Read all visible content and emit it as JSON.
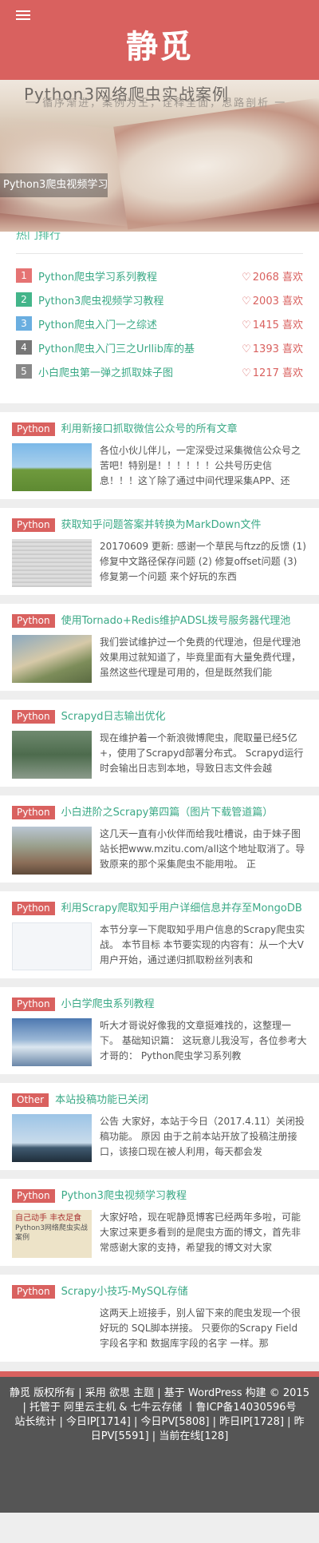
{
  "site": {
    "title": "静觅"
  },
  "banner": {
    "image_title_line1": "Python3网络爬虫实战案例",
    "image_title_line2": "一 循序渐进，案例为王，诠释全面，思路剖析 一",
    "caption": "Python3爬虫视频学习教程"
  },
  "rank": {
    "title": "热门排行",
    "items": [
      {
        "num": "1",
        "color": "#e57373",
        "title": "Python爬虫学习系列教程",
        "likes": "2068 喜欢"
      },
      {
        "num": "2",
        "color": "#43b58a",
        "title": "Python3爬虫视频学习教程",
        "likes": "2003 喜欢"
      },
      {
        "num": "3",
        "color": "#6aaee0",
        "title": "Python爬虫入门一之综述",
        "likes": "1415 喜欢"
      },
      {
        "num": "4",
        "color": "#777777",
        "title": "Python爬虫入门三之Urllib库的基",
        "likes": "1393 喜欢"
      },
      {
        "num": "5",
        "color": "#888888",
        "title": "小白爬虫第一弹之抓取妹子图",
        "likes": "1217 喜欢"
      }
    ]
  },
  "posts": [
    {
      "category": "Python",
      "title": "利用新接口抓取微信公众号的所有文章",
      "thumb": "t1",
      "excerpt": "各位小伙儿伴儿，一定深受过采集微信公众号之苦吧！特别是！！！！！！公共号历史信息！！！这丫除了通过中间代理采集APP、还"
    },
    {
      "category": "Python",
      "title": "获取知乎问题答案并转换为MarkDown文件",
      "thumb": "t2",
      "excerpt": "20170609 更新: 感谢一个草民与ftzz的反馈 (1) 修复中文路径保存问题 (2) 修复offset问题 (3) 修复第一个问题 来个好玩的东西"
    },
    {
      "category": "Python",
      "title": "使用Tornado+Redis维护ADSL拨号服务器代理池",
      "thumb": "t3",
      "excerpt": "我们尝试维护过一个免费的代理池，但是代理池效果用过就知道了，毕竟里面有大量免费代理，虽然这些代理是可用的，但是既然我们能"
    },
    {
      "category": "Python",
      "title": "Scrapyd日志输出优化",
      "thumb": "t4",
      "excerpt": "现在维护着一个新浪微博爬虫，爬取量已经5亿+，使用了Scrapyd部署分布式。 Scrapyd运行时会输出日志到本地，导致日志文件会越"
    },
    {
      "category": "Python",
      "title": "小白进阶之Scrapy第四篇（图片下载管道篇）",
      "thumb": "t5",
      "excerpt": "这几天一直有小伙伴而给我吐槽说，由于妹子图站长把www.mzitu.com/all这个地址取消了。导致原来的那个采集爬虫不能用啦。 正"
    },
    {
      "category": "Python",
      "title": "利用Scrapy爬取知乎用户详细信息并存至MongoDB",
      "thumb": "t6",
      "excerpt": "本节分享一下爬取知乎用户信息的Scrapy爬虫实战。 本节目标 本节要实现的内容有：从一个大V用户开始，通过递归抓取粉丝列表和"
    },
    {
      "category": "Python",
      "title": "小白学爬虫系列教程",
      "thumb": "t7",
      "excerpt": "听大才哥说好像我的文章挺难找的，这整理一下。 基础知识篇： 这玩意儿我没写，各位参考大才哥的： Python爬虫学习系列教"
    },
    {
      "category": "Other",
      "title": "本站投稿功能已关闭",
      "thumb": "t8",
      "excerpt": "公告 大家好，本站于今日（2017.4.11）关闭投稿功能。 原因 由于之前本站开放了投稿注册接口，该接口现在被人利用，每天都会发"
    },
    {
      "category": "Python",
      "title": "Python3爬虫视频学习教程",
      "thumb": "t9",
      "thumb_text": "自己动手 丰衣足食",
      "thumb_text2": "Python3网络爬虫实战案例",
      "excerpt": "大家好哈，现在呢静觅博客已经两年多啦，可能大家过来更多看到的是爬虫方面的博文，首先非常感谢大家的支持，希望我的博文对大家"
    },
    {
      "category": "Python",
      "title": "Scrapy小技巧-MySQL存储",
      "thumb": "t10",
      "excerpt": "这两天上班接手，别人留下来的爬虫发现一个很好玩的 SQL脚本拼接。 只要你的Scrapy Field字段名字和 数据库字段的名字 一样。那"
    }
  ],
  "footer": {
    "line1": "静觅 版权所有 | 采用 欲思 主题 | 基于 WordPress 构建 © 2015 | 托管于 阿里云主机 & 七牛云存储 丨鲁ICP备14030596号",
    "line2": "站长统计 | 今日IP[1714] | 今日PV[5808] | 昨日IP[1728] | 昨日PV[5591] | 当前在线[128]"
  },
  "colors": {
    "brand": "#d9615f",
    "link": "#3aa986",
    "footer": "#555555"
  }
}
